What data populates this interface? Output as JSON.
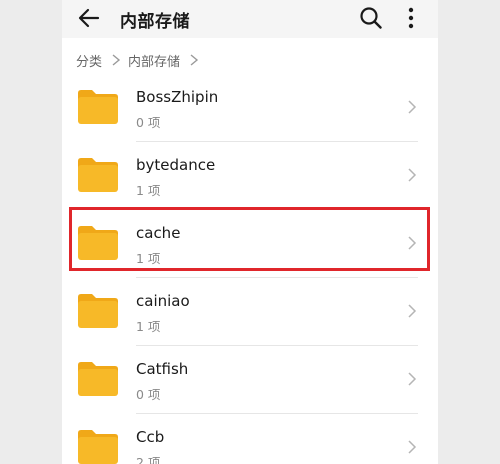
{
  "header": {
    "title": "内部存储",
    "back_icon": "arrow-left-icon",
    "search_icon": "search-icon",
    "more_icon": "more-vertical-icon"
  },
  "breadcrumb": {
    "items": [
      "分类",
      "内部存储"
    ]
  },
  "folders": [
    {
      "name": "BossZhipin",
      "count": "0 项"
    },
    {
      "name": "bytedance",
      "count": "1 项"
    },
    {
      "name": "cache",
      "count": "1 项"
    },
    {
      "name": "cainiao",
      "count": "1 项"
    },
    {
      "name": "Catfish",
      "count": "0 项"
    },
    {
      "name": "Ccb",
      "count": "2 项"
    }
  ],
  "colors": {
    "folder": "#f7b928",
    "folder_tab": "#f0a818",
    "highlight": "#e0262b",
    "side_bg": "#ececec"
  }
}
